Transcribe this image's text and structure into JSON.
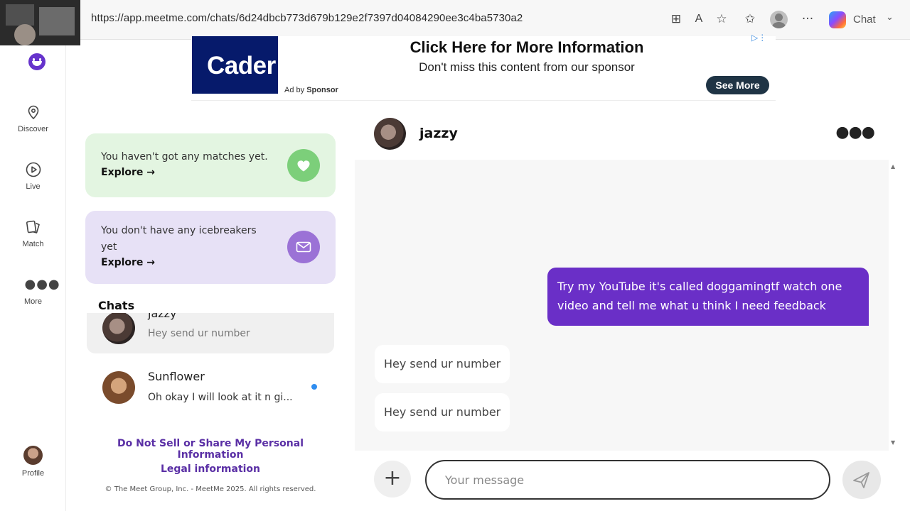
{
  "browser": {
    "url": "https://app.meetme.com/chats/6d24dbcb773d679b129e2f7397d04084290ee3c4ba5730a2",
    "chat_label": "Chat"
  },
  "nav": {
    "items": [
      {
        "label": "Discover",
        "icon": "location-pin-icon"
      },
      {
        "label": "Live",
        "icon": "play-circle-icon"
      },
      {
        "label": "Match",
        "icon": "cards-icon"
      },
      {
        "label": "More",
        "icon": "more-dots-icon"
      }
    ],
    "profile_label": "Profile"
  },
  "ad": {
    "logo_text": "Cader",
    "title": "Click Here for More Information",
    "subtitle": "Don't miss this content from our sponsor",
    "ad_by": "Ad by",
    "sponsor": "Sponsor",
    "cta": "See More"
  },
  "matches_card": {
    "text": "You haven't got any matches yet.",
    "link": "Explore →",
    "color": "#7ccf7a"
  },
  "icebreakers_card": {
    "text": "You don't have any icebreakers yet",
    "link": "Explore →",
    "color": "#9b72d6"
  },
  "chats": {
    "heading": "Chats",
    "list": [
      {
        "name": "jazzy",
        "preview": "Hey send ur number"
      },
      {
        "name": "Sunflower",
        "preview": "Oh okay I will look at it n gi..."
      }
    ]
  },
  "footer": {
    "privacy_link": "Do Not Sell or Share My Personal Information",
    "legal_link": "Legal information",
    "copyright": "© The Meet Group, Inc. - MeetMe 2025. All rights reserved."
  },
  "conversation": {
    "name": "jazzy",
    "messages": [
      {
        "direction": "outgoing",
        "text": "Try my YouTube it's called doggamingtf watch one video and tell me what u think I need feedback"
      },
      {
        "direction": "incoming",
        "text": "Hey send ur number"
      },
      {
        "direction": "incoming",
        "text": "Hey send ur number"
      }
    ],
    "input_placeholder": "Your message"
  },
  "colors": {
    "brand_purple": "#6633cc",
    "outgoing_bubble": "#6a2fc7",
    "link_purple": "#5a2fa5"
  }
}
